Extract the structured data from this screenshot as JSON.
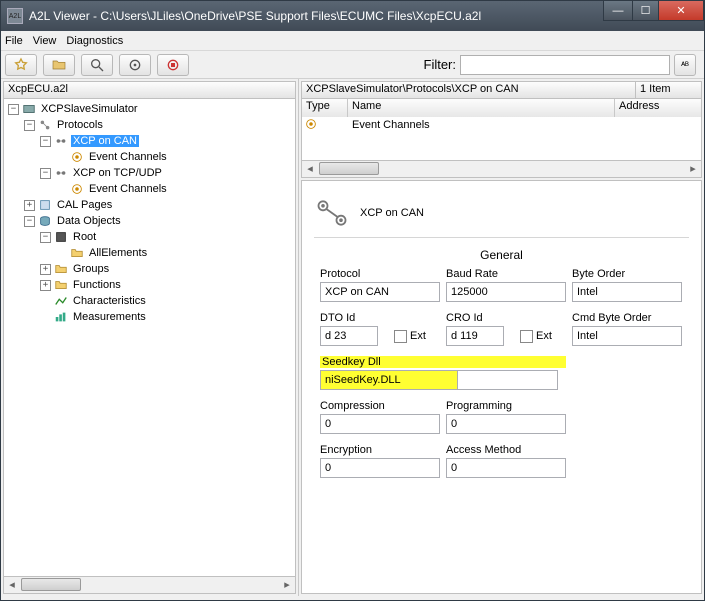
{
  "window": {
    "title": "A2L Viewer - C:\\Users\\JLiles\\OneDrive\\PSE Support Files\\ECUMC Files\\XcpECU.a2l",
    "app_icon_text": "A2L"
  },
  "menu": {
    "file": "File",
    "view": "View",
    "diagnostics": "Diagnostics"
  },
  "filter": {
    "label": "Filter:",
    "value": ""
  },
  "left": {
    "title": "XcpECU.a2l",
    "tree": {
      "root": "XCPSlaveSimulator",
      "protocols": "Protocols",
      "xcp_can": "XCP on CAN",
      "ev1": "Event Channels",
      "xcp_tcp": "XCP on TCP/UDP",
      "ev2": "Event Channels",
      "cal": "CAL Pages",
      "data": "Data Objects",
      "rootnode": "Root",
      "all": "AllElements",
      "groups": "Groups",
      "functions": "Functions",
      "chars": "Characteristics",
      "meas": "Measurements"
    }
  },
  "right": {
    "breadcrumb": "XCPSlaveSimulator\\Protocols\\XCP on CAN",
    "count": "1 Item",
    "cols": {
      "type": "Type",
      "name": "Name",
      "address": "Address"
    },
    "row1_name": "Event Channels",
    "heading": "XCP on CAN",
    "section": "General",
    "labels": {
      "protocol": "Protocol",
      "baud": "Baud Rate",
      "byteorder": "Byte Order",
      "dto": "DTO Id",
      "ext": "Ext",
      "cro": "CRO Id",
      "cmdbyte": "Cmd Byte Order",
      "seedkey": "Seedkey Dll",
      "compression": "Compression",
      "programming": "Programming",
      "encryption": "Encryption",
      "access": "Access Method"
    },
    "values": {
      "protocol": "XCP on CAN",
      "baud": "125000",
      "byteorder": "Intel",
      "dto": "d 23",
      "cro": "d 119",
      "cmdbyte": "Intel",
      "seedkey": "niSeedKey.DLL",
      "compression": "0",
      "programming": "0",
      "encryption": "0",
      "access": "0"
    }
  }
}
